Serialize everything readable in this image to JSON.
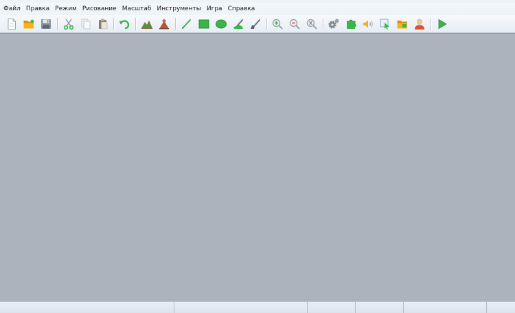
{
  "menu": {
    "items": [
      {
        "label": "Файл"
      },
      {
        "label": "Правка"
      },
      {
        "label": "Режим"
      },
      {
        "label": "Рисование"
      },
      {
        "label": "Масштаб"
      },
      {
        "label": "Инструменты"
      },
      {
        "label": "Игра"
      },
      {
        "label": "Справка"
      }
    ]
  },
  "toolbar": {
    "buttons": [
      {
        "icon": "new-document-icon"
      },
      {
        "icon": "open-folder-icon"
      },
      {
        "icon": "save-icon"
      },
      {
        "icon": "cut-icon"
      },
      {
        "icon": "copy-icon"
      },
      {
        "icon": "paste-icon"
      },
      {
        "icon": "undo-icon"
      },
      {
        "icon": "terrain-icon"
      },
      {
        "icon": "object-icon"
      },
      {
        "icon": "pencil-icon"
      },
      {
        "icon": "rectangle-icon"
      },
      {
        "icon": "ellipse-icon"
      },
      {
        "icon": "fill-icon"
      },
      {
        "icon": "brush-icon"
      },
      {
        "icon": "zoom-in-icon"
      },
      {
        "icon": "zoom-out-icon"
      },
      {
        "icon": "zoom-reset-icon"
      },
      {
        "icon": "settings-icon"
      },
      {
        "icon": "plugin-icon"
      },
      {
        "icon": "sound-icon"
      },
      {
        "icon": "map-select-icon"
      },
      {
        "icon": "resources-folder-icon"
      },
      {
        "icon": "user-icon"
      },
      {
        "icon": "play-icon"
      }
    ]
  },
  "status": {
    "panels": [
      {
        "text": ""
      },
      {
        "text": ""
      },
      {
        "text": ""
      },
      {
        "text": ""
      },
      {
        "text": ""
      },
      {
        "text": ""
      }
    ]
  },
  "colors": {
    "workspace": "#acb3bc",
    "accent_green": "#3bb54a",
    "folder_orange": "#f2a30c"
  }
}
